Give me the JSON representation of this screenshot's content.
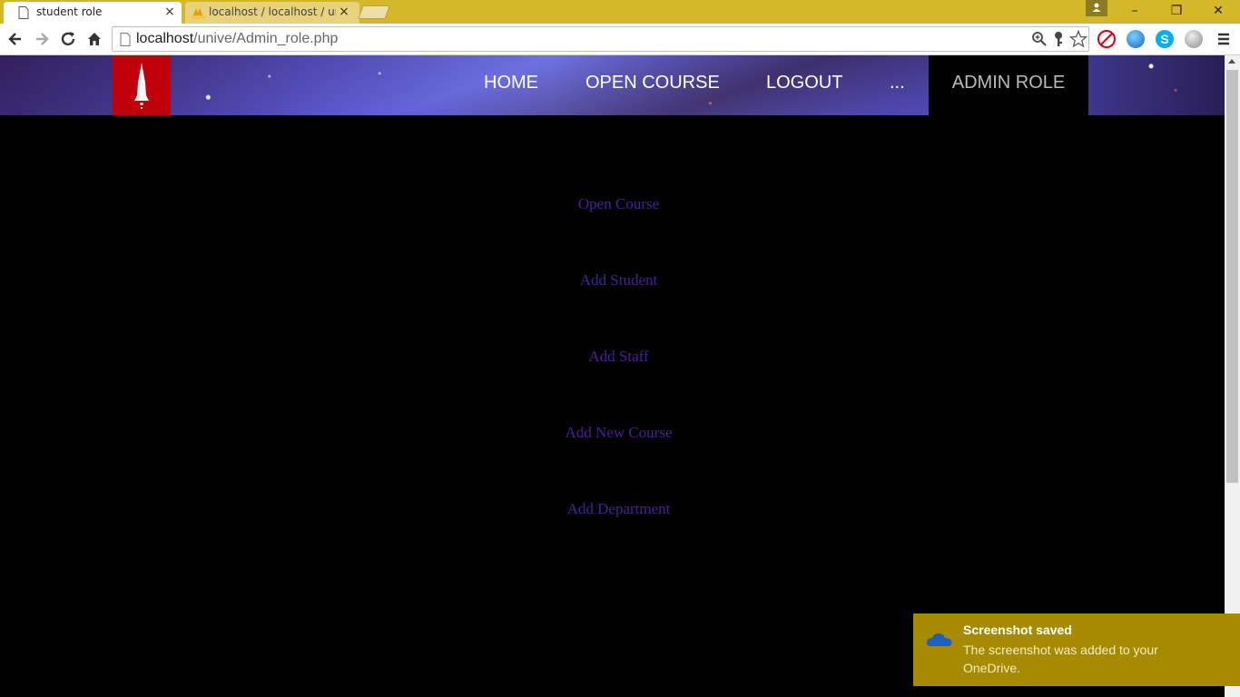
{
  "browser": {
    "tabs": [
      {
        "title": "student role",
        "active": true
      },
      {
        "title": "localhost / localhost / uni",
        "active": false
      }
    ],
    "window_buttons": {
      "minimize": "–",
      "restore": "❐",
      "close": "✕"
    },
    "url_host": "localhost",
    "url_path": "/unive/Admin_role.php"
  },
  "site": {
    "nav": {
      "home": "HOME",
      "open_course": "OPEN COURSE",
      "logout": "LOGOUT",
      "more": "...",
      "admin_role": "ADMIN ROLE"
    },
    "menu": [
      "Open Course",
      "Add Student",
      "Add Staff",
      "Add New Course",
      "Add Department"
    ]
  },
  "toast": {
    "title": "Screenshot saved",
    "body": "The screenshot was added to your OneDrive."
  },
  "colors": {
    "titlebar": "#d4b82a",
    "logo": "#c1000b",
    "menu_link": "#4b1f9c",
    "toast": "#a68b00"
  }
}
